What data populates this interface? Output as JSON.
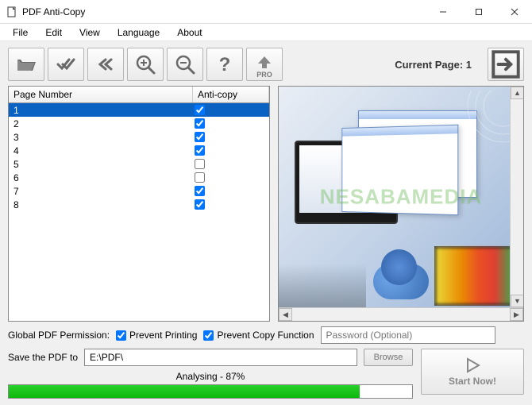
{
  "titlebar": {
    "title": "PDF Anti-Copy"
  },
  "menu": {
    "items": [
      "File",
      "Edit",
      "View",
      "Language",
      "About"
    ]
  },
  "toolbar": {
    "current_page_label": "Current Page: 1",
    "pro_label": "PRO"
  },
  "table": {
    "headers": {
      "page": "Page Number",
      "anticopy": "Anti-copy"
    },
    "rows": [
      {
        "page": "1",
        "checked": true,
        "selected": true
      },
      {
        "page": "2",
        "checked": true,
        "selected": false
      },
      {
        "page": "3",
        "checked": true,
        "selected": false
      },
      {
        "page": "4",
        "checked": true,
        "selected": false
      },
      {
        "page": "5",
        "checked": false,
        "selected": false
      },
      {
        "page": "6",
        "checked": false,
        "selected": false
      },
      {
        "page": "7",
        "checked": true,
        "selected": false
      },
      {
        "page": "8",
        "checked": true,
        "selected": false
      }
    ]
  },
  "permissions": {
    "label": "Global PDF Permission:",
    "prevent_printing_label": "Prevent Printing",
    "prevent_printing_checked": true,
    "prevent_copy_label": "Prevent Copy Function",
    "prevent_copy_checked": true,
    "password_placeholder": "Password (Optional)"
  },
  "save": {
    "label": "Save the PDF to",
    "path": "E:\\PDF\\",
    "browse_label": "Browse"
  },
  "progress": {
    "label": "Analysing - 87%",
    "percent": 87
  },
  "start": {
    "label": "Start Now!"
  },
  "watermark": "NESABAMEDIA"
}
